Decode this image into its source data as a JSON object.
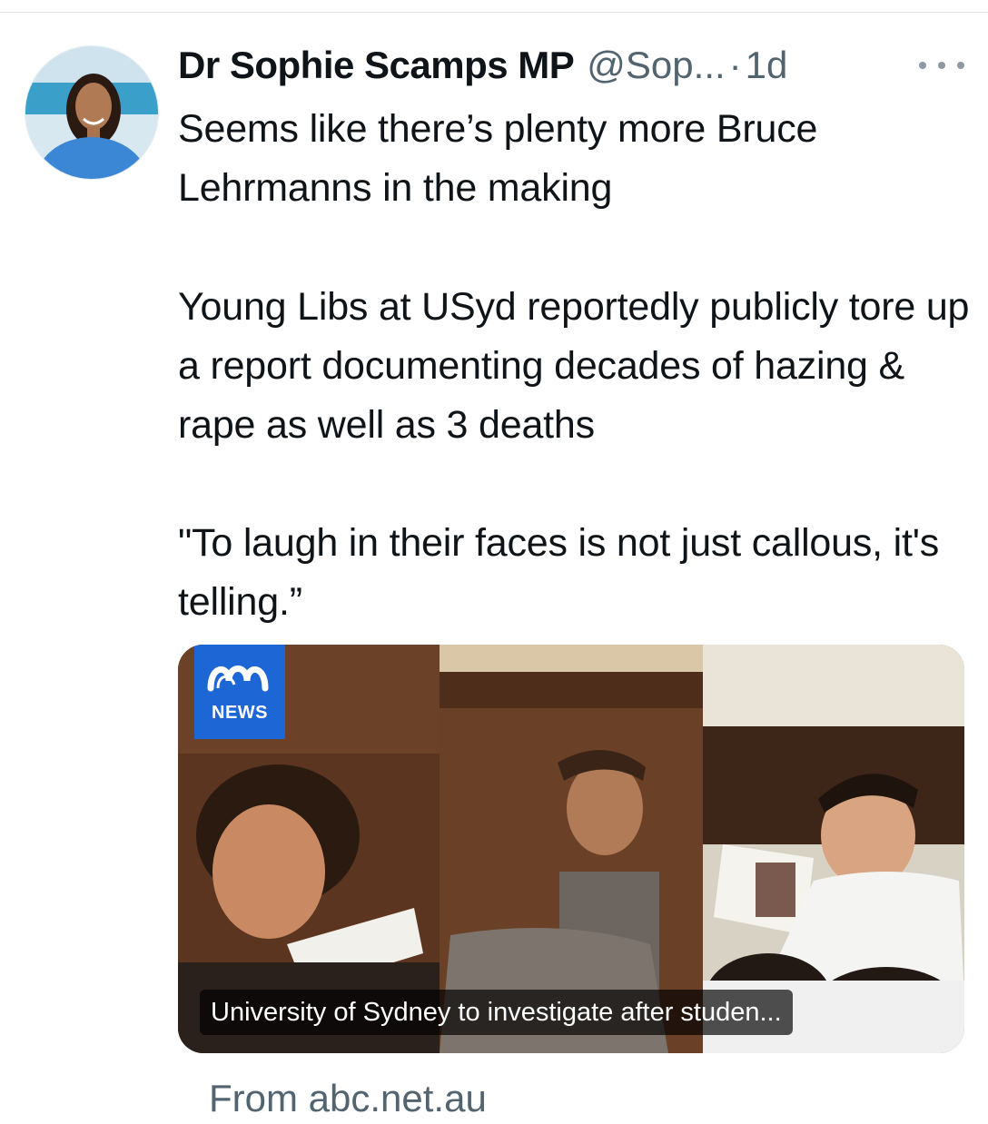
{
  "tweet": {
    "author_name": "Dr Sophie Scamps MP",
    "handle": "@Sop...",
    "separator": "·",
    "time": "1d",
    "paragraphs": [
      "Seems like there’s plenty more Bruce Lehrmanns in the making",
      "Young Libs at USyd reportedly publicly tore up a report documenting decades of hazing & rape as well as 3 deaths",
      "\"To laugh in their faces is not just callous, it's telling.”"
    ]
  },
  "card": {
    "logo_label": "NEWS",
    "caption": "University of Sydney to investigate after studen...",
    "source": "From abc.net.au"
  },
  "icons": {
    "more": "more-horizontal-icon",
    "avatar": "profile-photo",
    "logo": "abc-news-logo"
  },
  "colors": {
    "text_primary": "#0f1419",
    "text_secondary": "#536471",
    "abc_blue": "#1d66d6"
  }
}
